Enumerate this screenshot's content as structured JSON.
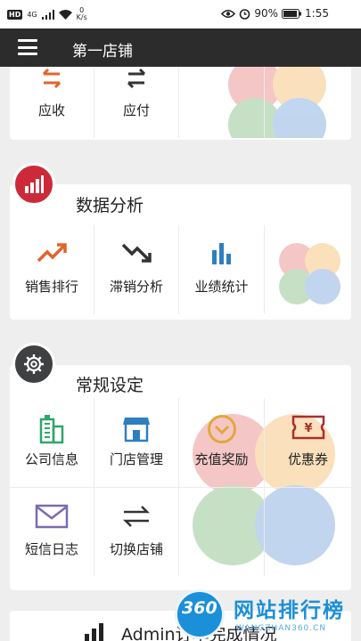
{
  "status_bar": {
    "network_badge": "HD",
    "signal": "4G",
    "net_speed_value": "0",
    "net_speed_unit": "K/s",
    "battery": "90%",
    "time": "1:55"
  },
  "app_bar": {
    "title": "第一店铺",
    "menu_icon": "hamburger-menu-icon"
  },
  "finance_section": {
    "items": [
      {
        "label": "应收",
        "icon": "receivable-arrows-icon",
        "color": "#e0642a"
      },
      {
        "label": "应付",
        "icon": "payable-arrows-icon",
        "color": "#333333"
      }
    ]
  },
  "analysis_section": {
    "title": "数据分析",
    "badge_icon": "bar-chart-icon",
    "badge_color": "#cc2a3a",
    "items": [
      {
        "label": "销售排行",
        "icon": "trend-up-icon",
        "color": "#e0642a"
      },
      {
        "label": "滞销分析",
        "icon": "trend-down-icon",
        "color": "#333333"
      },
      {
        "label": "业绩统计",
        "icon": "bars-icon",
        "color": "#2e7fc0"
      }
    ]
  },
  "settings_section": {
    "title": "常规设定",
    "badge_icon": "gear-icon",
    "badge_color": "#3f4042",
    "items": [
      {
        "label": "公司信息",
        "icon": "building-icon",
        "color": "#2fa66a"
      },
      {
        "label": "门店管理",
        "icon": "store-icon",
        "color": "#2e7fc0"
      },
      {
        "label": "充值奖励",
        "icon": "check-circle-icon",
        "color": "#e2a73a"
      },
      {
        "label": "优惠券",
        "icon": "coupon-icon",
        "color": "#a8302f"
      },
      {
        "label": "短信日志",
        "icon": "envelope-icon",
        "color": "#7b6bb0"
      },
      {
        "label": "切换店铺",
        "icon": "switch-arrows-icon",
        "color": "#333333"
      }
    ]
  },
  "report_section": {
    "title": "Admin订单完成情况",
    "badge_icon": "bar-chart-icon"
  },
  "watermark": {
    "badge": "360",
    "text": "网站排行榜",
    "sub": "WANGZHAN360.CN"
  }
}
